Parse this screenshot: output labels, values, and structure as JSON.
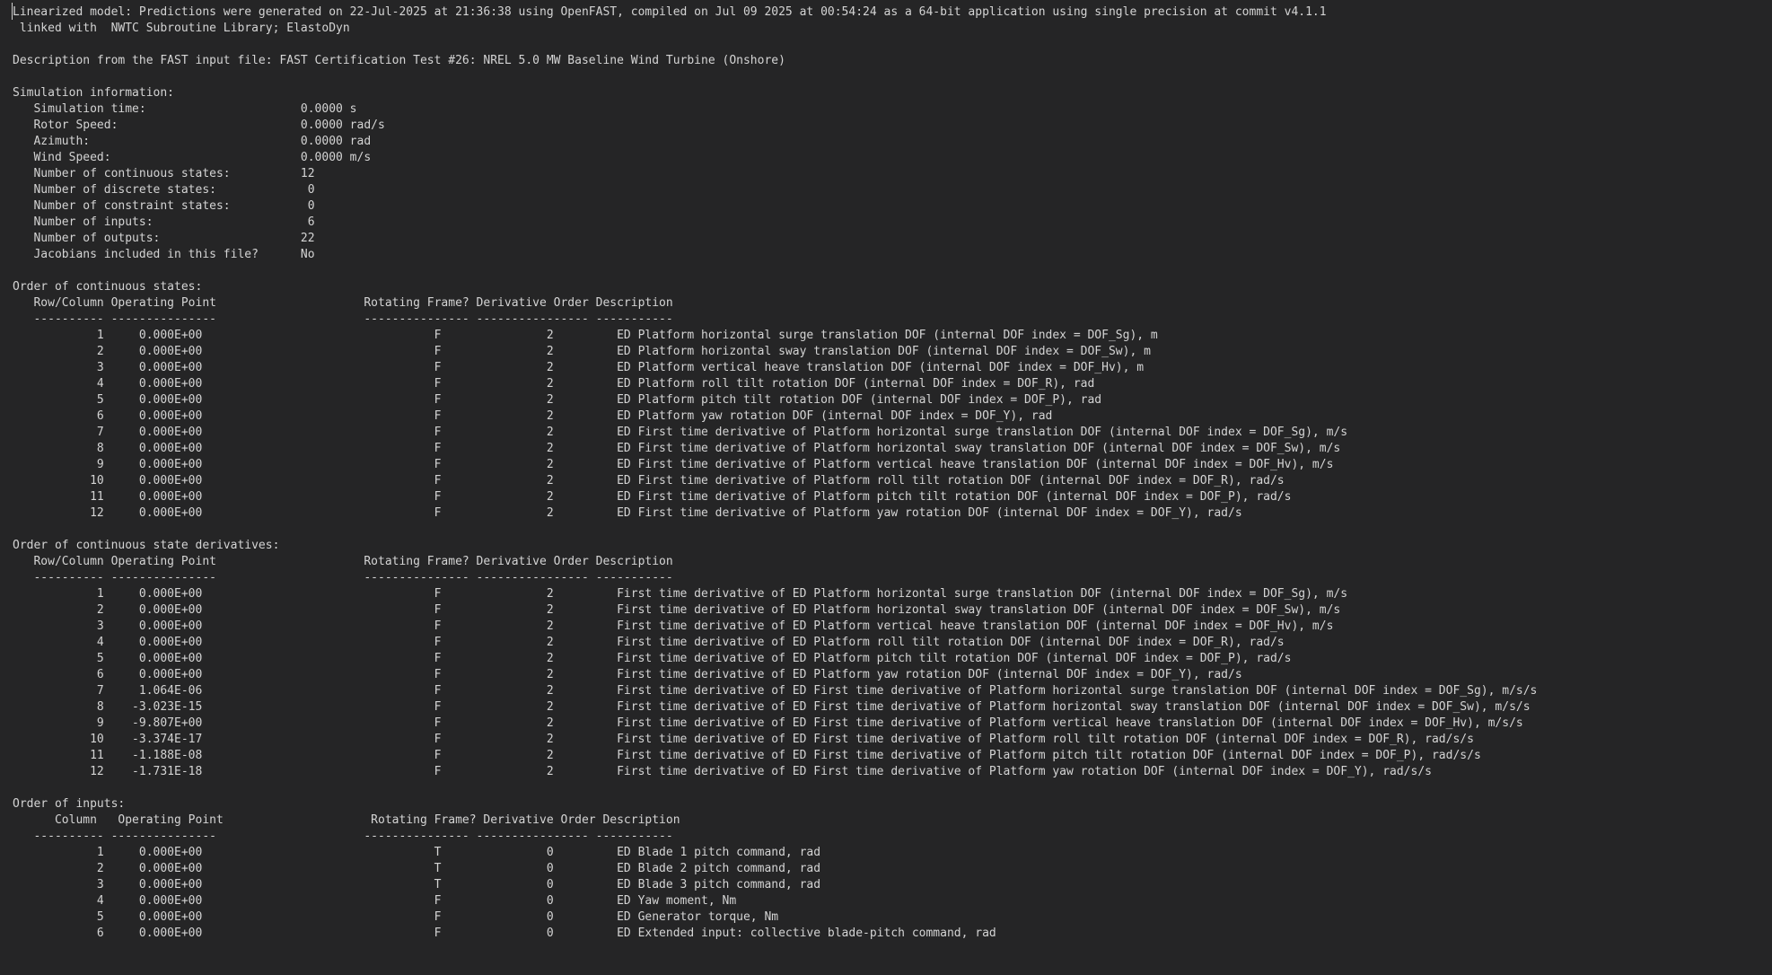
{
  "header": {
    "line1": "Linearized model: Predictions were generated on 22-Jul-2025 at 21:36:38 using OpenFAST, compiled on Jul 09 2025 at 00:54:24 as a 64-bit application using single precision at commit v4.1.1",
    "line2": " linked with  NWTC Subroutine Library; ElastoDyn"
  },
  "description": "Description from the FAST input file: FAST Certification Test #26: NREL 5.0 MW Baseline Wind Turbine (Onshore)",
  "simulation_info": {
    "title": "Simulation information:",
    "items": [
      {
        "label": "Simulation time:",
        "value": "0.0000 s"
      },
      {
        "label": "Rotor Speed:",
        "value": "0.0000 rad/s"
      },
      {
        "label": "Azimuth:",
        "value": "0.0000 rad"
      },
      {
        "label": "Wind Speed:",
        "value": "0.0000 m/s"
      },
      {
        "label": "Number of continuous states:",
        "value": "12"
      },
      {
        "label": "Number of discrete states:",
        "value": "0"
      },
      {
        "label": "Number of constraint states:",
        "value": "0"
      },
      {
        "label": "Number of inputs:",
        "value": "6"
      },
      {
        "label": "Number of outputs:",
        "value": "22"
      },
      {
        "label": "Jacobians included in this file?",
        "value": "No"
      }
    ]
  },
  "sections": [
    {
      "title": "Order of continuous states:",
      "header": "   Row/Column Operating Point                     Rotating Frame? Derivative Order Description",
      "rows": [
        {
          "num": "1",
          "op": "0.000E+00",
          "rot": "F",
          "ord": "2",
          "desc": "ED Platform horizontal surge translation DOF (internal DOF index = DOF_Sg), m"
        },
        {
          "num": "2",
          "op": "0.000E+00",
          "rot": "F",
          "ord": "2",
          "desc": "ED Platform horizontal sway translation DOF (internal DOF index = DOF_Sw), m"
        },
        {
          "num": "3",
          "op": "0.000E+00",
          "rot": "F",
          "ord": "2",
          "desc": "ED Platform vertical heave translation DOF (internal DOF index = DOF_Hv), m"
        },
        {
          "num": "4",
          "op": "0.000E+00",
          "rot": "F",
          "ord": "2",
          "desc": "ED Platform roll tilt rotation DOF (internal DOF index = DOF_R), rad"
        },
        {
          "num": "5",
          "op": "0.000E+00",
          "rot": "F",
          "ord": "2",
          "desc": "ED Platform pitch tilt rotation DOF (internal DOF index = DOF_P), rad"
        },
        {
          "num": "6",
          "op": "0.000E+00",
          "rot": "F",
          "ord": "2",
          "desc": "ED Platform yaw rotation DOF (internal DOF index = DOF_Y), rad"
        },
        {
          "num": "7",
          "op": "0.000E+00",
          "rot": "F",
          "ord": "2",
          "desc": "ED First time derivative of Platform horizontal surge translation DOF (internal DOF index = DOF_Sg), m/s"
        },
        {
          "num": "8",
          "op": "0.000E+00",
          "rot": "F",
          "ord": "2",
          "desc": "ED First time derivative of Platform horizontal sway translation DOF (internal DOF index = DOF_Sw), m/s"
        },
        {
          "num": "9",
          "op": "0.000E+00",
          "rot": "F",
          "ord": "2",
          "desc": "ED First time derivative of Platform vertical heave translation DOF (internal DOF index = DOF_Hv), m/s"
        },
        {
          "num": "10",
          "op": "0.000E+00",
          "rot": "F",
          "ord": "2",
          "desc": "ED First time derivative of Platform roll tilt rotation DOF (internal DOF index = DOF_R), rad/s"
        },
        {
          "num": "11",
          "op": "0.000E+00",
          "rot": "F",
          "ord": "2",
          "desc": "ED First time derivative of Platform pitch tilt rotation DOF (internal DOF index = DOF_P), rad/s"
        },
        {
          "num": "12",
          "op": "0.000E+00",
          "rot": "F",
          "ord": "2",
          "desc": "ED First time derivative of Platform yaw rotation DOF (internal DOF index = DOF_Y), rad/s"
        }
      ]
    },
    {
      "title": "Order of continuous state derivatives:",
      "header": "   Row/Column Operating Point                     Rotating Frame? Derivative Order Description",
      "rows": [
        {
          "num": "1",
          "op": "0.000E+00",
          "rot": "F",
          "ord": "2",
          "desc": "First time derivative of ED Platform horizontal surge translation DOF (internal DOF index = DOF_Sg), m/s"
        },
        {
          "num": "2",
          "op": "0.000E+00",
          "rot": "F",
          "ord": "2",
          "desc": "First time derivative of ED Platform horizontal sway translation DOF (internal DOF index = DOF_Sw), m/s"
        },
        {
          "num": "3",
          "op": "0.000E+00",
          "rot": "F",
          "ord": "2",
          "desc": "First time derivative of ED Platform vertical heave translation DOF (internal DOF index = DOF_Hv), m/s"
        },
        {
          "num": "4",
          "op": "0.000E+00",
          "rot": "F",
          "ord": "2",
          "desc": "First time derivative of ED Platform roll tilt rotation DOF (internal DOF index = DOF_R), rad/s"
        },
        {
          "num": "5",
          "op": "0.000E+00",
          "rot": "F",
          "ord": "2",
          "desc": "First time derivative of ED Platform pitch tilt rotation DOF (internal DOF index = DOF_P), rad/s"
        },
        {
          "num": "6",
          "op": "0.000E+00",
          "rot": "F",
          "ord": "2",
          "desc": "First time derivative of ED Platform yaw rotation DOF (internal DOF index = DOF_Y), rad/s"
        },
        {
          "num": "7",
          "op": "1.064E-06",
          "rot": "F",
          "ord": "2",
          "desc": "First time derivative of ED First time derivative of Platform horizontal surge translation DOF (internal DOF index = DOF_Sg), m/s/s"
        },
        {
          "num": "8",
          "op": "-3.023E-15",
          "rot": "F",
          "ord": "2",
          "desc": "First time derivative of ED First time derivative of Platform horizontal sway translation DOF (internal DOF index = DOF_Sw), m/s/s"
        },
        {
          "num": "9",
          "op": "-9.807E+00",
          "rot": "F",
          "ord": "2",
          "desc": "First time derivative of ED First time derivative of Platform vertical heave translation DOF (internal DOF index = DOF_Hv), m/s/s"
        },
        {
          "num": "10",
          "op": "-3.374E-17",
          "rot": "F",
          "ord": "2",
          "desc": "First time derivative of ED First time derivative of Platform roll tilt rotation DOF (internal DOF index = DOF_R), rad/s/s"
        },
        {
          "num": "11",
          "op": "-1.188E-08",
          "rot": "F",
          "ord": "2",
          "desc": "First time derivative of ED First time derivative of Platform pitch tilt rotation DOF (internal DOF index = DOF_P), rad/s/s"
        },
        {
          "num": "12",
          "op": "-1.731E-18",
          "rot": "F",
          "ord": "2",
          "desc": "First time derivative of ED First time derivative of Platform yaw rotation DOF (internal DOF index = DOF_Y), rad/s/s"
        }
      ]
    },
    {
      "title": "Order of inputs:",
      "header": "      Column   Operating Point                     Rotating Frame? Derivative Order Description",
      "rows": [
        {
          "num": "1",
          "op": "0.000E+00",
          "rot": "T",
          "ord": "0",
          "desc": "ED Blade 1 pitch command, rad"
        },
        {
          "num": "2",
          "op": "0.000E+00",
          "rot": "T",
          "ord": "0",
          "desc": "ED Blade 2 pitch command, rad"
        },
        {
          "num": "3",
          "op": "0.000E+00",
          "rot": "T",
          "ord": "0",
          "desc": "ED Blade 3 pitch command, rad"
        },
        {
          "num": "4",
          "op": "0.000E+00",
          "rot": "F",
          "ord": "0",
          "desc": "ED Yaw moment, Nm"
        },
        {
          "num": "5",
          "op": "0.000E+00",
          "rot": "F",
          "ord": "0",
          "desc": "ED Generator torque, Nm"
        },
        {
          "num": "6",
          "op": "0.000E+00",
          "rot": "F",
          "ord": "0",
          "desc": "ED Extended input: collective blade-pitch command, rad"
        }
      ]
    }
  ],
  "divider": "   ---------- ---------------                     --------------- ---------------- -----------"
}
